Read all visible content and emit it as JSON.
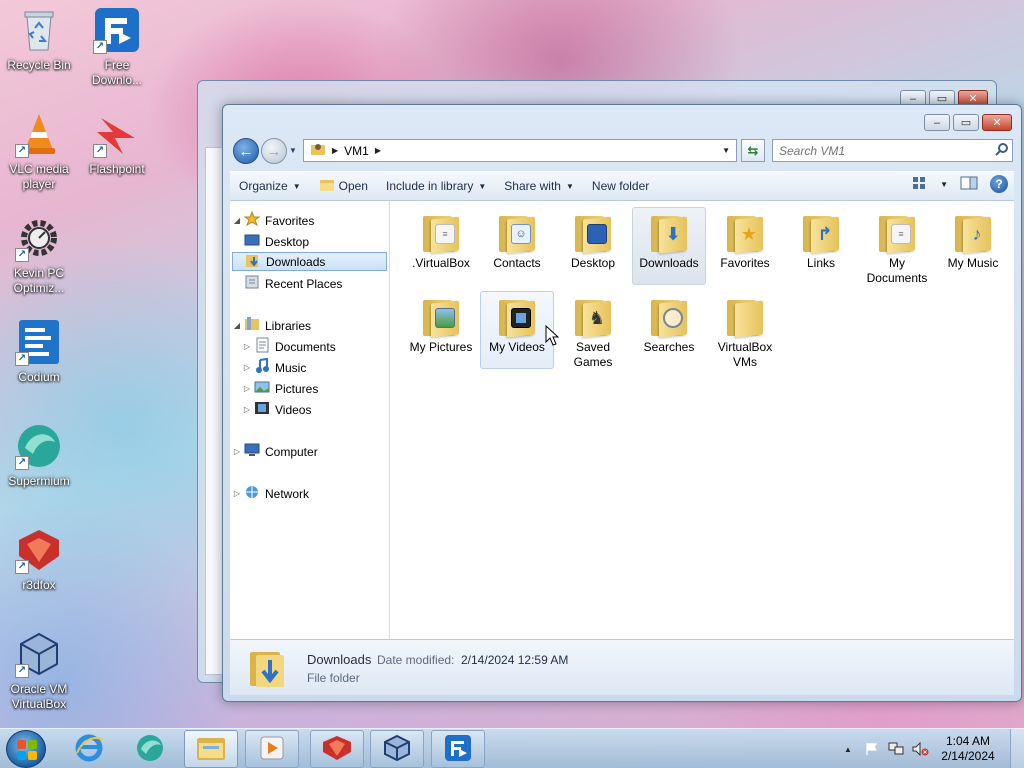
{
  "desktop": {
    "icons": [
      {
        "label": "Recycle Bin",
        "icon": "recycle-bin-icon"
      },
      {
        "label": "Free Downlo...",
        "icon": "free-download-manager-icon"
      },
      {
        "label": "VLC media player",
        "icon": "vlc-icon"
      },
      {
        "label": "Flashpoint",
        "icon": "flashpoint-icon"
      },
      {
        "label": "Kevin PC Optimiz...",
        "icon": "gear-icon"
      },
      {
        "label": "Codium",
        "icon": "codium-icon"
      },
      {
        "label": "Supermium",
        "icon": "supermium-icon"
      },
      {
        "label": "r3dfox",
        "icon": "r3dfox-icon"
      },
      {
        "label": "Oracle VM VirtualBox",
        "icon": "virtualbox-icon"
      }
    ]
  },
  "window": {
    "controls": {
      "minimize": "–",
      "maximize": "▭",
      "close": "✕"
    },
    "address": {
      "root_icon": "user-folder-icon",
      "crumb": "VM1"
    },
    "search": {
      "placeholder": "Search VM1"
    },
    "toolbar": {
      "organize": "Organize",
      "open": "Open",
      "include_in_library": "Include in library",
      "share_with": "Share with",
      "new_folder": "New folder",
      "help": "?"
    },
    "nav": {
      "favorites": "Favorites",
      "desktop": "Desktop",
      "downloads": "Downloads",
      "recent_places": "Recent Places",
      "libraries": "Libraries",
      "documents": "Documents",
      "music": "Music",
      "pictures": "Pictures",
      "videos": "Videos",
      "computer": "Computer",
      "network": "Network"
    },
    "items": [
      {
        "label": ".VirtualBox",
        "badge": "doc"
      },
      {
        "label": "Contacts",
        "badge": "contact"
      },
      {
        "label": "Desktop",
        "badge": "desktop"
      },
      {
        "label": "Downloads",
        "badge": "download"
      },
      {
        "label": "Favorites",
        "badge": "star"
      },
      {
        "label": "Links",
        "badge": "link"
      },
      {
        "label": "My Documents",
        "badge": "doc"
      },
      {
        "label": "My Music",
        "badge": "music"
      },
      {
        "label": "My Pictures",
        "badge": "picture"
      },
      {
        "label": "My Videos",
        "badge": "video"
      },
      {
        "label": "Saved Games",
        "badge": "chess"
      },
      {
        "label": "Searches",
        "badge": "search"
      },
      {
        "label": "VirtualBox VMs",
        "badge": "none"
      }
    ],
    "details": {
      "name": "Downloads",
      "date_label": "Date modified:",
      "date_value": "2/14/2024 12:59 AM",
      "type": "File folder"
    }
  },
  "taskbar": {
    "clock_time": "1:04 AM",
    "clock_date": "2/14/2024"
  }
}
